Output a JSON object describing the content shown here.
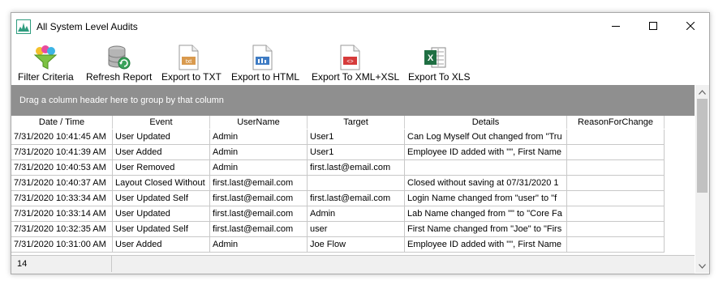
{
  "window": {
    "title": "All System Level Audits",
    "controls": [
      "minimize-icon",
      "maximize-icon",
      "close-icon"
    ]
  },
  "toolbar": {
    "items": [
      {
        "label": "Filter Criteria",
        "icon": "filter-funnel-icon"
      },
      {
        "label": "Refresh Report",
        "icon": "database-refresh-icon"
      },
      {
        "label": "Export to TXT",
        "icon": "txt-file-icon"
      },
      {
        "label": "Export to HTML",
        "icon": "html-file-icon"
      },
      {
        "label": "Export To XML+XSL",
        "icon": "xml-file-icon"
      },
      {
        "label": "Export To XLS",
        "icon": "excel-file-icon"
      }
    ]
  },
  "group_panel": {
    "text": "Drag a column header here to group by that column"
  },
  "grid": {
    "columns": [
      "Date / Time",
      "Event",
      "UserName",
      "Target",
      "Details",
      "ReasonForChange"
    ],
    "rows": [
      [
        "7/31/2020 10:41:45 AM",
        "User Updated",
        "Admin",
        "User1",
        "Can Log Myself Out changed from \"Tru",
        ""
      ],
      [
        "7/31/2020 10:41:39 AM",
        "User Added",
        "Admin",
        "User1",
        "Employee ID added with \"\", First Name",
        ""
      ],
      [
        "7/31/2020 10:40:53 AM",
        "User Removed",
        "Admin",
        "first.last@email.com",
        "",
        ""
      ],
      [
        "7/31/2020 10:40:37 AM",
        "Layout Closed Without",
        "first.last@email.com",
        "",
        "Closed without saving at 07/31/2020 1",
        ""
      ],
      [
        "7/31/2020 10:33:34 AM",
        "User Updated Self",
        "first.last@email.com",
        "first.last@email.com",
        "Login Name changed from \"user\" to \"f",
        ""
      ],
      [
        "7/31/2020 10:33:14 AM",
        "User Updated",
        "first.last@email.com",
        "Admin",
        "Lab Name changed from \"\" to \"Core Fa",
        ""
      ],
      [
        "7/31/2020 10:32:35 AM",
        "User Updated Self",
        "first.last@email.com",
        "user",
        "First Name changed from \"Joe\" to \"Firs",
        ""
      ],
      [
        "7/31/2020 10:31:00 AM",
        "User Added",
        "Admin",
        "Joe Flow",
        "Employee ID added with \"\", First Name",
        ""
      ]
    ],
    "row_count": "14"
  }
}
